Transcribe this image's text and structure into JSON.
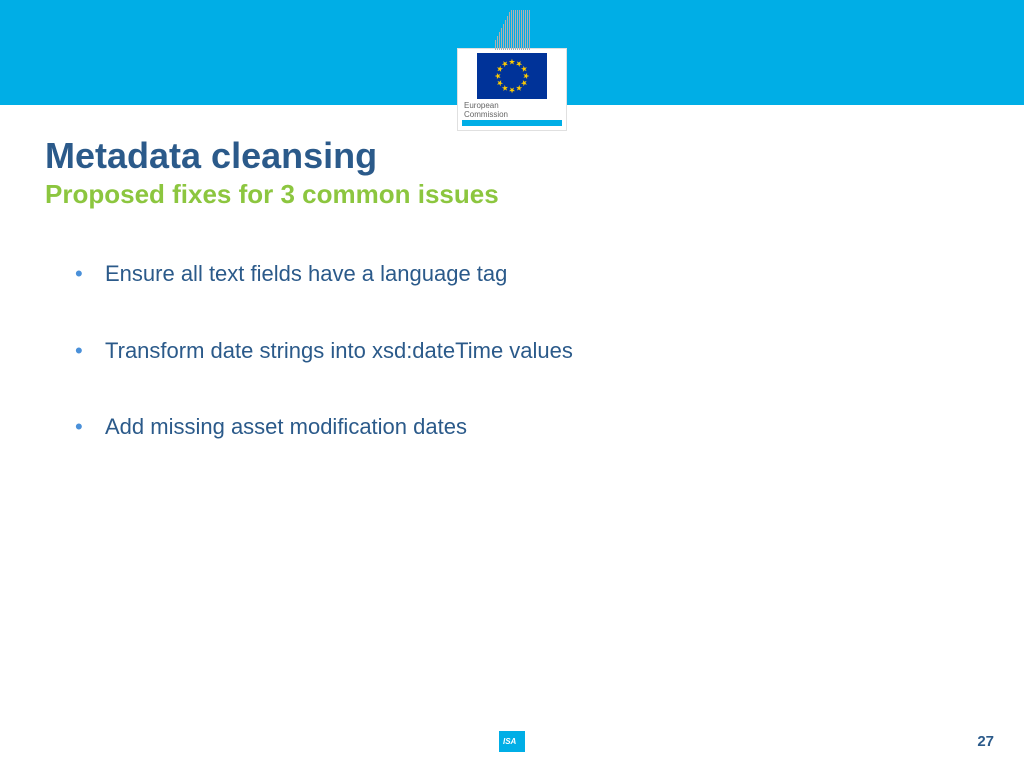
{
  "logo": {
    "label_line1": "European",
    "label_line2": "Commission"
  },
  "title": "Metadata cleansing",
  "subtitle": "Proposed fixes for 3 common issues",
  "bullets": [
    "Ensure all text fields have a language tag",
    "Transform date strings into xsd:dateTime values",
    "Add missing asset modification dates"
  ],
  "footer": {
    "badge": "ISA",
    "page": "27"
  }
}
